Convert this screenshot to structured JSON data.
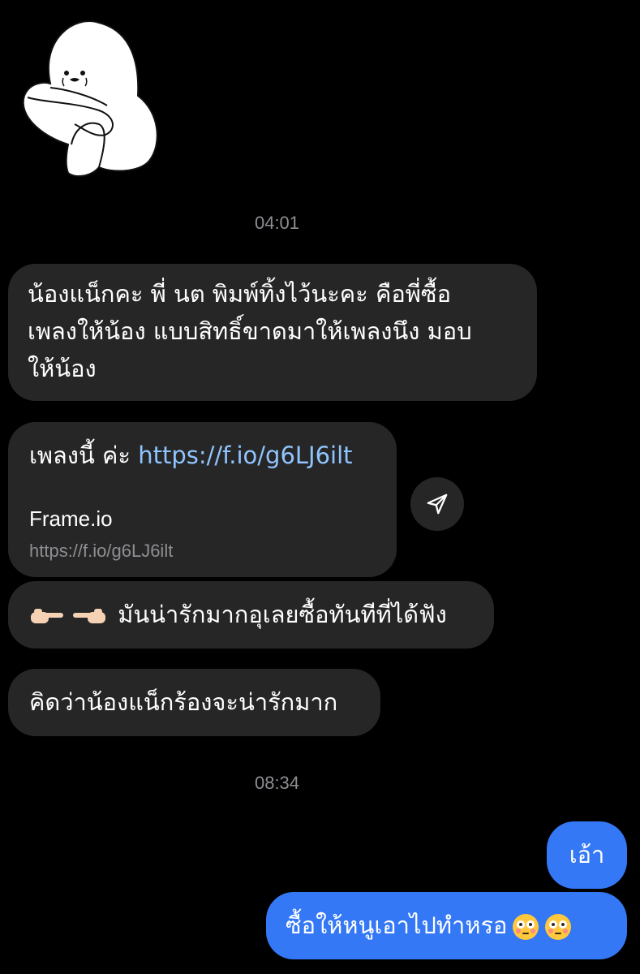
{
  "thread": {
    "timestamps": [
      "04:01",
      "08:34"
    ],
    "incoming": [
      {
        "lines": [
          "น้องแน็กคะ พี่ นต พิมพ์ทิ้งไว้นะคะ คือพี่ซื้อ",
          "เพลงให้น้อง แบบสิทธิ์ขาดมาให้เพลงนึง มอบ",
          "ให้น้อง"
        ]
      },
      {
        "prefix": "เพลงนี้ ค่ะ ",
        "link": "https://f.io/g6LJ6ilt",
        "preview_title": "Frame.io",
        "preview_url": "https://f.io/g6LJ6ilt"
      },
      {
        "emoji_icons": [
          "pointing-right-hand-icon",
          "pointing-left-hand-icon"
        ],
        "text": "มันน่ารักมากอุเลยซื้อทันทีที่ได้ฟัง"
      },
      {
        "text": "คิดว่าน้องแน็กร้องจะน่ารักมาก"
      }
    ],
    "outgoing": [
      {
        "text": "เอ้า"
      },
      {
        "text": "ซื้อให้หนูเอาไปทำหรอ",
        "emoji_icons": [
          "flushed-face-icon",
          "flushed-face-icon"
        ]
      }
    ]
  },
  "colors": {
    "background": "#000000",
    "incoming_bubble": "#262626",
    "outgoing_bubble": "#3478f6",
    "link": "#8fc4ff",
    "timestamp": "#8e8e93"
  },
  "icons": {
    "sticker": "crying-blob-sticker-icon",
    "share": "paper-plane-share-icon"
  }
}
